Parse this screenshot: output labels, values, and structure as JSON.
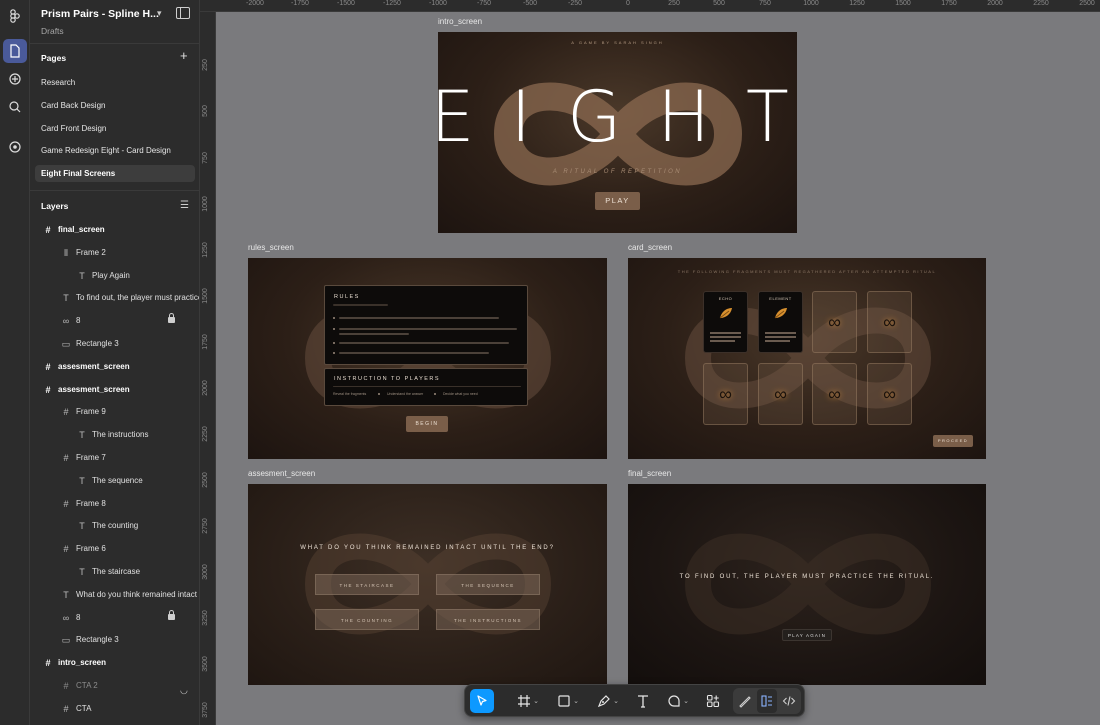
{
  "file": {
    "title": "Prism Pairs - Spline H...",
    "subtitle": "Drafts"
  },
  "pages": {
    "heading": "Pages",
    "items": [
      {
        "label": "Research"
      },
      {
        "label": "Card Back Design"
      },
      {
        "label": "Card Front Design"
      },
      {
        "label": "Game Redesign Eight - Card Design"
      },
      {
        "label": "Eight Final Screens",
        "selected": true
      }
    ]
  },
  "layers": {
    "heading": "Layers",
    "items": [
      {
        "label": "final_screen",
        "icon": "frame-icon",
        "level": 0
      },
      {
        "label": "Frame 2",
        "icon": "autolayout-icon",
        "level": 1
      },
      {
        "label": "Play Again",
        "icon": "text-icon",
        "level": 2
      },
      {
        "label": "To find out, the player must practice the ritual.",
        "icon": "text-icon",
        "level": 1
      },
      {
        "label": "8",
        "icon": "link-icon",
        "level": 1,
        "locked": true
      },
      {
        "label": "Rectangle 3",
        "icon": "rectangle-icon",
        "level": 1
      },
      {
        "label": "assesment_screen",
        "icon": "frame-icon",
        "level": 0
      },
      {
        "label": "assesment_screen",
        "icon": "frame-icon",
        "level": 0
      },
      {
        "label": "Frame 9",
        "icon": "frame-icon",
        "level": 1
      },
      {
        "label": "The instructions",
        "icon": "text-icon",
        "level": 2
      },
      {
        "label": "Frame 7",
        "icon": "frame-icon",
        "level": 1
      },
      {
        "label": "The sequence",
        "icon": "text-icon",
        "level": 2
      },
      {
        "label": "Frame 8",
        "icon": "frame-icon",
        "level": 1
      },
      {
        "label": "The counting",
        "icon": "text-icon",
        "level": 2
      },
      {
        "label": "Frame 6",
        "icon": "frame-icon",
        "level": 1
      },
      {
        "label": "The staircase",
        "icon": "text-icon",
        "level": 2
      },
      {
        "label": "What do you think remained intact until the end?",
        "icon": "text-icon",
        "level": 1
      },
      {
        "label": "8",
        "icon": "link-icon",
        "level": 1,
        "locked": true
      },
      {
        "label": "Rectangle 3",
        "icon": "rectangle-icon",
        "level": 1
      },
      {
        "label": "intro_screen",
        "icon": "frame-icon",
        "level": 0
      },
      {
        "label": "CTA 2",
        "icon": "frame-icon",
        "level": 1,
        "hidden": true
      },
      {
        "label": "CTA",
        "icon": "frame-icon",
        "level": 1
      }
    ]
  },
  "rulers": {
    "top": [
      "-2000",
      "-1750",
      "-1500",
      "-1250",
      "-1000",
      "-750",
      "-500",
      "-250",
      "0",
      "250",
      "500",
      "750",
      "1000",
      "1250",
      "1500",
      "1750",
      "2000",
      "2250",
      "2500"
    ],
    "left": [
      "250",
      "500",
      "750",
      "1000",
      "1250",
      "1500",
      "1750",
      "2000",
      "2250",
      "2500",
      "2750",
      "3000",
      "3250",
      "3500",
      "3750"
    ]
  },
  "frames": {
    "intro": {
      "label": "intro_screen",
      "kicker": "A GAME BY SARAH SINGH",
      "title": "EIGHT",
      "subtitle": "A RITUAL OF REPETITION",
      "cta": "PLAY"
    },
    "rules": {
      "label": "rules_screen",
      "rules_heading": "RULES",
      "instruction_heading": "INSTRUCTION TO PLAYERS",
      "instruction_items": [
        "Reveal the fragments",
        "Understand the answer",
        "Decide what you need"
      ],
      "cta": "BEGIN"
    },
    "card": {
      "label": "card_screen",
      "heading": "THE FOLLOWING FRAGMENTS MUST REGATHERED AFTER AN ATTEMPTED RITUAL",
      "card1_title": "ECHO",
      "card2_title": "ELEMENT",
      "cta": "PROCEED"
    },
    "assessment": {
      "label": "assesment_screen",
      "question": "WHAT DO YOU THINK REMAINED INTACT UNTIL THE END?",
      "options": [
        "THE STAIRCASE",
        "THE SEQUENCE",
        "THE COUNTING",
        "THE INSTRUCTIONS"
      ]
    },
    "final": {
      "label": "final_screen",
      "message": "TO FIND OUT, THE PLAYER MUST PRACTICE THE RITUAL.",
      "cta": "PLAY AGAIN"
    }
  },
  "colors": {
    "accent": "#0d99ff",
    "canvas": "#7a7a7d",
    "panel": "#2c2c2c",
    "brand_brown": "#7a5e49"
  }
}
